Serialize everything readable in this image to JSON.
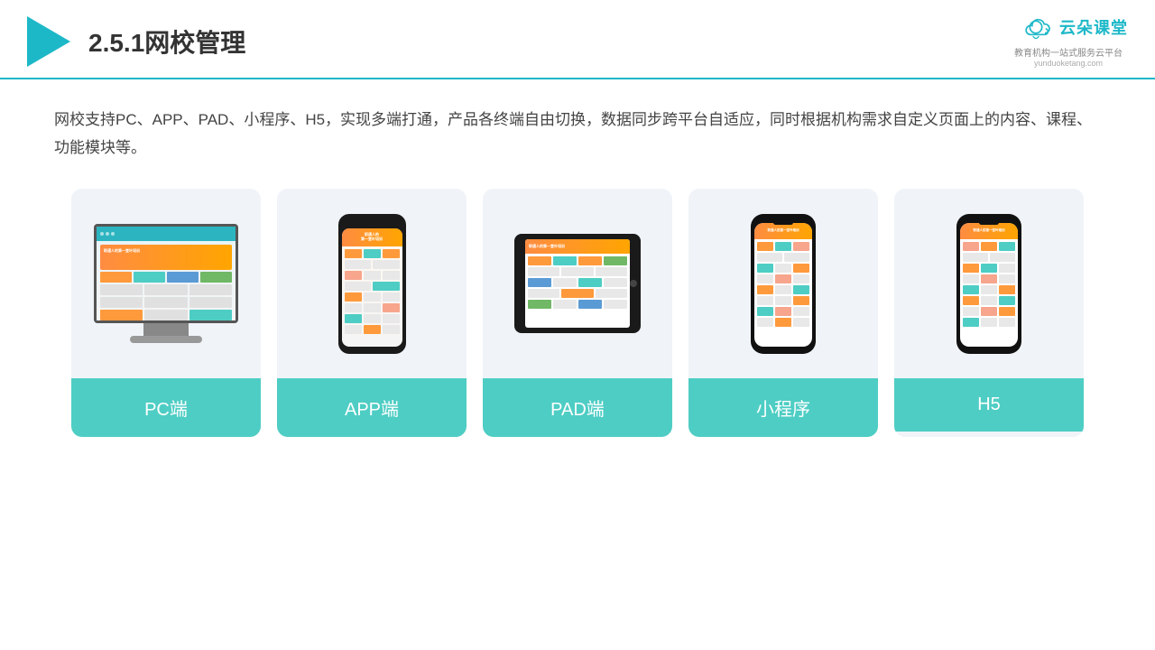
{
  "header": {
    "title": "2.5.1网校管理",
    "logo_text": "云朵课堂",
    "logo_subtitle": "教育机构一站\n式服务云平台",
    "logo_domain": "yunduoketang.com"
  },
  "description": "网校支持PC、APP、PAD、小程序、H5，实现多端打通，产品各终端自由切换，数据同步跨平台自适应，同时根据机构需求自定义页面上的内容、课程、功能模块等。",
  "cards": [
    {
      "id": "pc",
      "label": "PC端"
    },
    {
      "id": "app",
      "label": "APP端"
    },
    {
      "id": "pad",
      "label": "PAD端"
    },
    {
      "id": "mini",
      "label": "小程序"
    },
    {
      "id": "h5",
      "label": "H5"
    }
  ],
  "colors": {
    "accent": "#1db8c8",
    "card_bg": "#f0f4f8",
    "card_label_bg": "#4ecdc4",
    "card_label_text": "#ffffff"
  }
}
